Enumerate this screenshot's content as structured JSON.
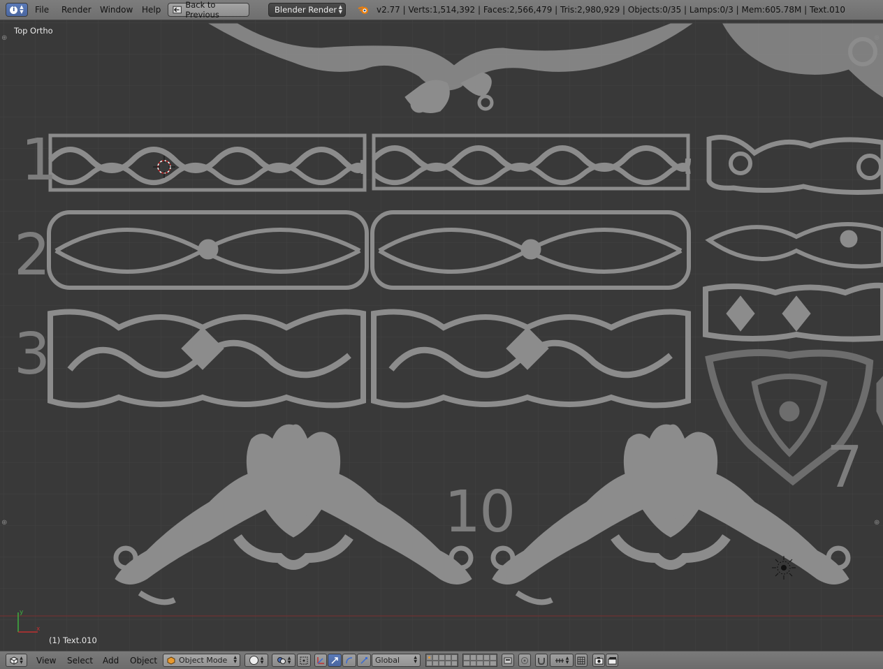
{
  "topbar": {
    "info_icon": "info-icon",
    "menus": [
      "File",
      "Render",
      "Window",
      "Help"
    ],
    "back_button": "Back to Previous",
    "render_engine": "Blender Render",
    "stats": "v2.77 | Verts:1,514,392 | Faces:2,566,479 | Tris:2,980,929 | Objects:0/35 | Lamps:0/3 | Mem:605.78M | Text.010"
  },
  "viewport": {
    "view_label": "Top Ortho",
    "object_label": "(1) Text.010",
    "axis_y": "y",
    "axis_x": "x",
    "row_numbers": [
      "1",
      "2",
      "3",
      "10",
      "7"
    ]
  },
  "bottombar": {
    "menus": [
      "View",
      "Select",
      "Add",
      "Object"
    ],
    "mode": "Object Mode",
    "orientation": "Global"
  },
  "colors": {
    "background": "#393939",
    "ornament": "#8a8a8a",
    "header": "#727272",
    "x_axis": "#b03030",
    "y_axis": "#3a9a3a"
  }
}
